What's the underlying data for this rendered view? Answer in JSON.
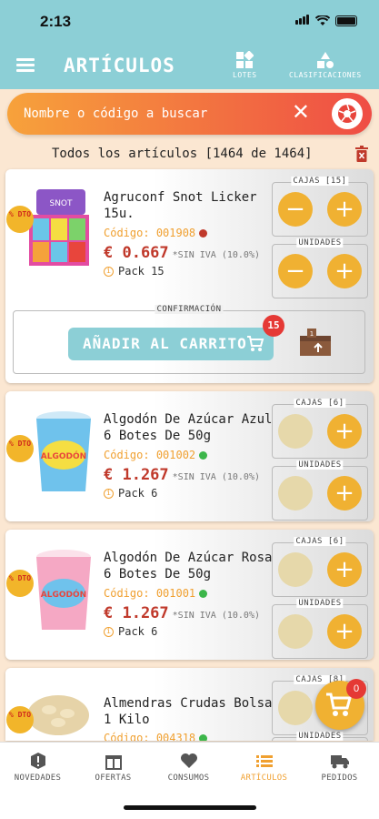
{
  "status_bar": {
    "time": "2:13"
  },
  "header": {
    "title": "ARTÍCULOS",
    "lotes_label": "LOTES",
    "clasificaciones_label": "CLASIFICACIONES"
  },
  "search": {
    "placeholder": "Nombre o código a buscar"
  },
  "summary": {
    "text": "Todos los artículos [1464 de 1464]"
  },
  "products": [
    {
      "name": "Agruconf Snot Licker 15u.",
      "code_label": "Código:",
      "code": "001908",
      "dot_color": "#c0392b",
      "price": "€ 0.667",
      "vat": "*SIN IVA (10.0%)",
      "pack": "Pack 15",
      "dto": "% DTO",
      "boxes_label": "CAJAS [15]",
      "units_label": "UNIDADES"
    },
    {
      "name": "Algodón De Azúcar Azul 6 Botes De 50g",
      "code_label": "Código:",
      "code": "001002",
      "dot_color": "#3cb64a",
      "price": "€ 1.267",
      "vat": "*SIN IVA (10.0%)",
      "pack": "Pack 6",
      "dto": "% DTO",
      "boxes_label": "CAJAS [6]",
      "units_label": "UNIDADES"
    },
    {
      "name": "Algodón De Azúcar Rosa 6 Botes De 50g",
      "code_label": "Código:",
      "code": "001001",
      "dot_color": "#3cb64a",
      "price": "€ 1.267",
      "vat": "*SIN IVA (10.0%)",
      "pack": "Pack 6",
      "dto": "% DTO",
      "boxes_label": "CAJAS [6]",
      "units_label": "UNIDADES"
    },
    {
      "name": "Almendras Crudas Bolsa 1 Kilo",
      "code_label": "Código:",
      "code": "004318",
      "dot_color": "#3cb64a",
      "dto": "% DTO",
      "boxes_label": "CAJAS [8]",
      "units_label": "UNIDADES"
    }
  ],
  "confirm": {
    "label": "CONFIRMACIÓN",
    "button": "AÑADIR AL CARRITO",
    "badge": "15"
  },
  "fab": {
    "badge": "0"
  },
  "tabs": [
    {
      "label": "NOVEDADES",
      "icon": "alert-icon"
    },
    {
      "label": "OFERTAS",
      "icon": "gift-icon"
    },
    {
      "label": "CONSUMOS",
      "icon": "heart-icon"
    },
    {
      "label": "ARTÍCULOS",
      "icon": "list-icon"
    },
    {
      "label": "PEDIDOS",
      "icon": "truck-icon"
    }
  ],
  "colors": {
    "header": "#8ccfd6",
    "accent": "#f0b132",
    "price": "#c0392b",
    "code": "#f0a030"
  }
}
